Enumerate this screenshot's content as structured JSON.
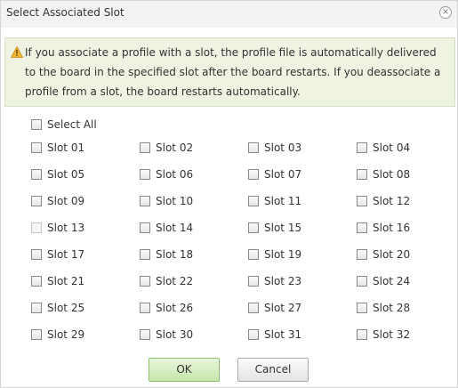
{
  "dialog": {
    "title": "Select Associated Slot",
    "close_label": "×"
  },
  "notice": {
    "text": "If you associate a profile with a slot, the profile file is automatically delivered to the board in the specified slot after the board restarts. If you deassociate a profile from a slot, the board restarts automatically.",
    "icon": "warning-triangle-icon",
    "icon_color": "#e8a317"
  },
  "select_all": {
    "label": "Select All",
    "checked": false
  },
  "slots": [
    {
      "label": "Slot 01",
      "checked": false,
      "disabled": false
    },
    {
      "label": "Slot 02",
      "checked": false,
      "disabled": false
    },
    {
      "label": "Slot 03",
      "checked": false,
      "disabled": false
    },
    {
      "label": "Slot 04",
      "checked": false,
      "disabled": false
    },
    {
      "label": "Slot 05",
      "checked": false,
      "disabled": false
    },
    {
      "label": "Slot 06",
      "checked": false,
      "disabled": false
    },
    {
      "label": "Slot 07",
      "checked": false,
      "disabled": false
    },
    {
      "label": "Slot 08",
      "checked": false,
      "disabled": false
    },
    {
      "label": "Slot 09",
      "checked": false,
      "disabled": false
    },
    {
      "label": "Slot 10",
      "checked": false,
      "disabled": false
    },
    {
      "label": "Slot 11",
      "checked": false,
      "disabled": false
    },
    {
      "label": "Slot 12",
      "checked": false,
      "disabled": false
    },
    {
      "label": "Slot 13",
      "checked": false,
      "disabled": true
    },
    {
      "label": "Slot 14",
      "checked": false,
      "disabled": false
    },
    {
      "label": "Slot 15",
      "checked": false,
      "disabled": false
    },
    {
      "label": "Slot 16",
      "checked": false,
      "disabled": false
    },
    {
      "label": "Slot 17",
      "checked": false,
      "disabled": false
    },
    {
      "label": "Slot 18",
      "checked": false,
      "disabled": false
    },
    {
      "label": "Slot 19",
      "checked": false,
      "disabled": false
    },
    {
      "label": "Slot 20",
      "checked": false,
      "disabled": false
    },
    {
      "label": "Slot 21",
      "checked": false,
      "disabled": false
    },
    {
      "label": "Slot 22",
      "checked": false,
      "disabled": false
    },
    {
      "label": "Slot 23",
      "checked": false,
      "disabled": false
    },
    {
      "label": "Slot 24",
      "checked": false,
      "disabled": false
    },
    {
      "label": "Slot 25",
      "checked": false,
      "disabled": false
    },
    {
      "label": "Slot 26",
      "checked": false,
      "disabled": false
    },
    {
      "label": "Slot 27",
      "checked": false,
      "disabled": false
    },
    {
      "label": "Slot 28",
      "checked": false,
      "disabled": false
    },
    {
      "label": "Slot 29",
      "checked": false,
      "disabled": false
    },
    {
      "label": "Slot 30",
      "checked": false,
      "disabled": false
    },
    {
      "label": "Slot 31",
      "checked": false,
      "disabled": false
    },
    {
      "label": "Slot 32",
      "checked": false,
      "disabled": false
    }
  ],
  "buttons": {
    "ok_label": "OK",
    "cancel_label": "Cancel",
    "ok_color": "#c6e6ab"
  }
}
